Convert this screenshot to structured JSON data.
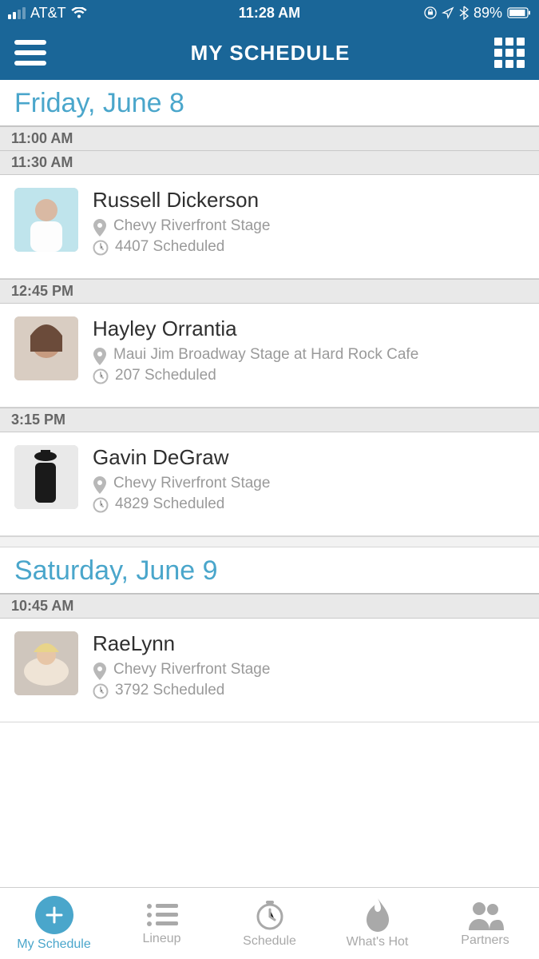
{
  "status": {
    "carrier": "AT&T",
    "time": "11:28 AM",
    "battery": "89%"
  },
  "header": {
    "title": "MY SCHEDULE"
  },
  "days": [
    {
      "label": "Friday, June 8",
      "slots": [
        {
          "time": "11:00 AM",
          "events": []
        },
        {
          "time": "11:30 AM",
          "events": [
            {
              "name": "Russell Dickerson",
              "venue": "Chevy Riverfront Stage",
              "scheduled": "4407 Scheduled",
              "avatar": "russell"
            }
          ]
        },
        {
          "time": "12:45 PM",
          "events": [
            {
              "name": "Hayley Orrantia",
              "venue": "Maui Jim Broadway Stage at Hard Rock Cafe",
              "scheduled": "207 Scheduled",
              "avatar": "hayley"
            }
          ]
        },
        {
          "time": "3:15 PM",
          "events": [
            {
              "name": "Gavin DeGraw",
              "venue": "Chevy Riverfront Stage",
              "scheduled": "4829 Scheduled",
              "avatar": "gavin"
            }
          ]
        }
      ]
    },
    {
      "label": "Saturday, June 9",
      "slots": [
        {
          "time": "10:45 AM",
          "events": [
            {
              "name": "RaeLynn",
              "venue": "Chevy Riverfront Stage",
              "scheduled": "3792 Scheduled",
              "avatar": "raelynn"
            }
          ]
        }
      ]
    }
  ],
  "tabs": [
    {
      "label": "My Schedule",
      "icon": "plus",
      "active": true
    },
    {
      "label": "Lineup",
      "icon": "list",
      "active": false
    },
    {
      "label": "Schedule",
      "icon": "clock",
      "active": false
    },
    {
      "label": "What's Hot",
      "icon": "flame",
      "active": false
    },
    {
      "label": "Partners",
      "icon": "people",
      "active": false
    }
  ]
}
